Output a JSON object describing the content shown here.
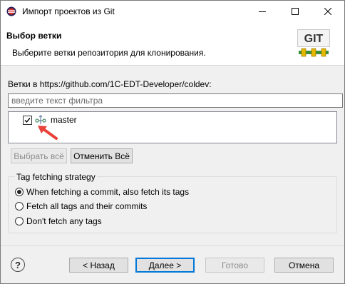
{
  "window": {
    "title": "Импорт проектов из Git"
  },
  "header": {
    "title": "Выбор ветки",
    "description": "Выберите ветки репозитория для клонирования.",
    "logo_text": "GIT"
  },
  "branches": {
    "label": "Ветки в https://github.com/1C-EDT-Developer/coldev:",
    "filter_placeholder": "введите текст фильтра",
    "items": [
      {
        "name": "master",
        "checked": true
      }
    ],
    "select_all_label": "Выбрать всё",
    "deselect_all_label": "Отменить Всё"
  },
  "tag_fetching": {
    "title": "Tag fetching strategy",
    "options": [
      {
        "label": "When fetching a commit, also fetch its tags",
        "selected": true
      },
      {
        "label": "Fetch all tags and their commits",
        "selected": false
      },
      {
        "label": "Don't fetch any tags",
        "selected": false
      }
    ]
  },
  "footer": {
    "back_label": "< Назад",
    "next_label": "Далее >",
    "finish_label": "Готово",
    "cancel_label": "Отмена"
  },
  "colors": {
    "accent": "#0078d7",
    "annotation_arrow": "#e8423a"
  }
}
